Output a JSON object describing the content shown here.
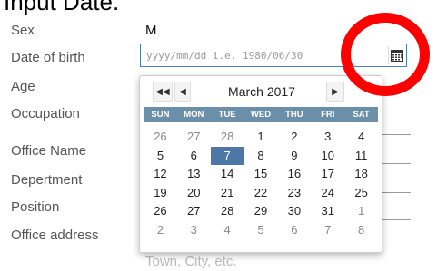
{
  "heading": "Input Date.",
  "form": {
    "sex_label": "Sex",
    "sex_value": "M",
    "dob_label": "Date of birth",
    "dob_placeholder": "yyyy/mm/dd i.e. 1980/06/30",
    "age_label": "Age",
    "occupation_label": "Occupation",
    "office_name_label": "Office Name",
    "department_label": "Depertment",
    "position_label": "Position",
    "office_address_label": "Office address",
    "address_placeholder_text": "Town, City, etc."
  },
  "calendar": {
    "month_title": "March 2017",
    "nav_prev_year": "◀◀",
    "nav_prev_month": "◀",
    "nav_next_month": "▶",
    "weekdays": [
      "SUN",
      "MON",
      "TUE",
      "WED",
      "THU",
      "FRI",
      "SAT"
    ],
    "weeks": [
      [
        "26",
        "27",
        "28",
        "1",
        "2",
        "3",
        "4"
      ],
      [
        "5",
        "6",
        "7",
        "8",
        "9",
        "10",
        "11"
      ],
      [
        "12",
        "13",
        "14",
        "15",
        "16",
        "17",
        "18"
      ],
      [
        "19",
        "20",
        "21",
        "22",
        "23",
        "24",
        "25"
      ],
      [
        "26",
        "27",
        "28",
        "29",
        "30",
        "31",
        "1"
      ],
      [
        "2",
        "3",
        "4",
        "5",
        "6",
        "7",
        "8"
      ]
    ],
    "selected_day": "7"
  },
  "colors": {
    "highlight_ring": "#ff0000",
    "weekday_header": "#6b8fa8",
    "selected_day": "#4d77a6",
    "input_border": "#4a7fc0"
  },
  "icons": {
    "calendar_button": "calendar-icon"
  }
}
